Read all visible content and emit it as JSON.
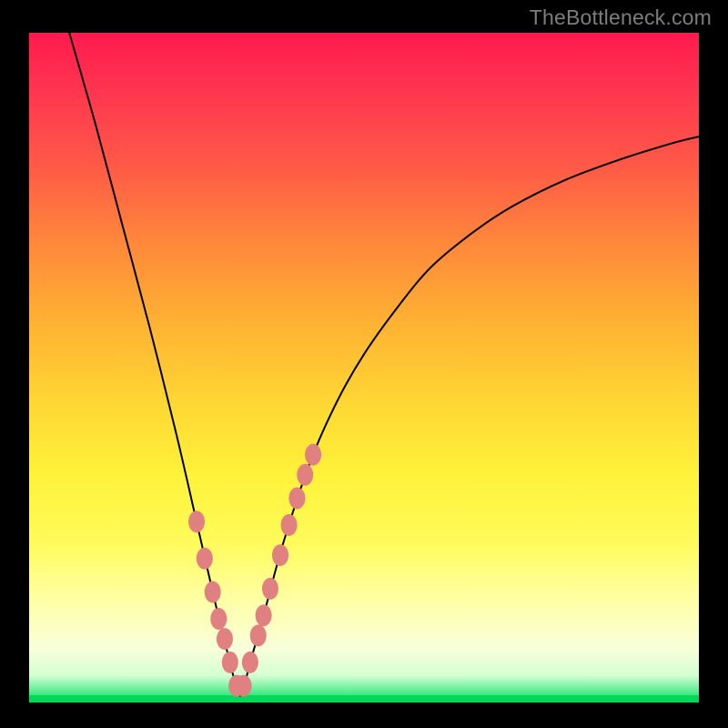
{
  "watermark": "TheBottleneck.com",
  "colors": {
    "page_bg": "#000000",
    "point_fill": "#e08080",
    "curve_stroke": "#000000"
  },
  "chart_data": {
    "type": "line",
    "title": "",
    "xlabel": "",
    "ylabel": "",
    "xlim": [
      0,
      100
    ],
    "ylim": [
      0,
      100
    ],
    "notes": "V-shaped bottleneck curve. Lower y = better (green); higher y = worse (red). Minimum near x≈31.5. Pink markers cluster around the minimum.",
    "series": [
      {
        "name": "bottleneck-curve",
        "x": [
          6,
          10,
          14,
          18,
          22,
          25,
          28,
          30,
          31.5,
          33,
          35,
          38,
          42,
          46,
          50,
          55,
          60,
          66,
          72,
          80,
          88,
          96,
          100
        ],
        "y": [
          100,
          86,
          71,
          56,
          40,
          27,
          14,
          6,
          1,
          6,
          13,
          24,
          36,
          45,
          52,
          59,
          65,
          70,
          74,
          78,
          81,
          83.5,
          84.5
        ]
      }
    ],
    "highlight_points": {
      "name": "markers",
      "x": [
        25.0,
        26.2,
        27.4,
        28.3,
        29.2,
        30.0,
        31.0,
        32.0,
        33.0,
        34.2,
        35.0,
        36.0,
        37.5,
        38.8,
        40.0,
        41.2,
        42.4
      ],
      "y": [
        27.0,
        21.5,
        16.5,
        12.5,
        9.5,
        6.0,
        2.5,
        2.5,
        6.0,
        10.0,
        13.0,
        17.0,
        22.0,
        26.5,
        30.5,
        34.0,
        37.0
      ]
    }
  }
}
